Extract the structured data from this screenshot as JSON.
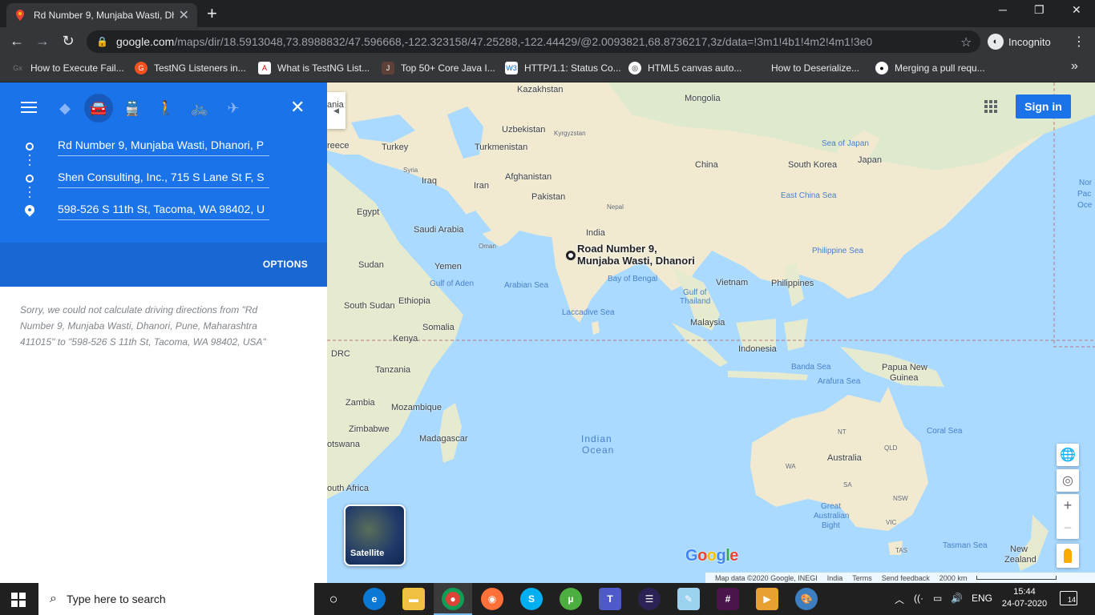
{
  "browser": {
    "tab_title": "Rd Number 9, Munjaba Wasti, Dh",
    "url_host": "google.com",
    "url_path": "/maps/dir/18.5913048,73.8988832/47.596668,-122.323158/47.25288,-122.44429/@2.0093821,68.8736217,3z/data=!3m1!4b1!4m2!4m1!3e0",
    "profile_label": "Incognito",
    "bookmarks": [
      "How to Execute Fail...",
      "TestNG Listeners in...",
      "What is TestNG List...",
      "Top 50+ Core Java I...",
      "HTTP/1.1: Status Co...",
      "HTML5 canvas auto...",
      "How to Deserialize...",
      "Merging a pull requ..."
    ],
    "bookmark_more": "»"
  },
  "directions": {
    "waypoints": [
      "Rd Number 9, Munjaba Wasti, Dhanori, P",
      "Shen Consulting, Inc., 715 S Lane St F, S",
      "598-526 S 11th St, Tacoma, WA 98402, U"
    ],
    "options_label": "OPTIONS",
    "error_message": "Sorry, we could not calculate driving directions from \"Rd Number 9, Munjaba Wasti, Dhanori, Pune, Maharashtra 411015\" to \"598-526 S 11th St, Tacoma, WA 98402, USA\""
  },
  "map": {
    "signin_label": "Sign in",
    "satellite_label": "Satellite",
    "marker_label_line1": "Road Number 9,",
    "marker_label_line2": "Munjaba Wasti, Dhanori",
    "google_logo": "Google",
    "footer": {
      "map_data": "Map data ©2020 Google, INEGI",
      "region": "India",
      "terms": "Terms",
      "feedback": "Send feedback",
      "scale": "2000 km"
    },
    "labels": {
      "kazakhstan": "Kazakhstan",
      "mongolia": "Mongolia",
      "uzbekistan": "Uzbekistan",
      "kyrgyzstan": "Kyrgyzstan",
      "turkmenistan": "Turkmenistan",
      "turkey": "Turkey",
      "greece": "reece",
      "syria": "Syria",
      "iraq": "Iraq",
      "iran": "Iran",
      "afghanistan": "Afghanistan",
      "pakistan": "Pakistan",
      "nepal": "Nepal",
      "china": "China",
      "south_korea": "South Korea",
      "japan": "Japan",
      "sea_of_japan": "Sea of Japan",
      "east_china_sea": "East China Sea",
      "egypt": "Egypt",
      "saudi_arabia": "Saudi Arabia",
      "oman": "Oman",
      "india": "India",
      "yemen": "Yemen",
      "sudan": "Sudan",
      "gulf_of_aden": "Gulf of Aden",
      "arabian_sea": "Arabian Sea",
      "bay_of_bengal": "Bay of Bengal",
      "vietnam": "Vietnam",
      "philippines": "Philippines",
      "philippine_sea": "Philippine Sea",
      "gulf_of_thailand_1": "Gulf of",
      "gulf_of_thailand_2": "Thailand",
      "south_sudan": "South Sudan",
      "ethiopia": "Ethiopia",
      "laccadive_sea": "Laccadive Sea",
      "somalia": "Somalia",
      "malaysia": "Malaysia",
      "kenya": "Kenya",
      "drc": "DRC",
      "indonesia": "Indonesia",
      "tanzania": "Tanzania",
      "banda_sea": "Banda Sea",
      "papua_1": "Papua New",
      "papua_2": "Guinea",
      "arafura_sea": "Arafura Sea",
      "zambia": "Zambia",
      "mozambique": "Mozambique",
      "nt": "NT",
      "qld": "QLD",
      "coral_sea": "Coral Sea",
      "zimbabwe": "Zimbabwe",
      "indian_ocean_1": "Indian",
      "indian_ocean_2": "Ocean",
      "madagascar": "Madagascar",
      "botswana": "otswana",
      "wa": "WA",
      "australia": "Australia",
      "sa": "SA",
      "nsw": "NSW",
      "south_africa": "outh Africa",
      "great_australian_1": "Great",
      "great_australian_2": "Australian",
      "great_australian_3": "Bight",
      "vic": "VIC",
      "tas": "TAS",
      "tasman_sea": "Tasman Sea",
      "new_zealand_1": "New",
      "new_zealand_2": "Zealand",
      "north_pacific_1": "Nor",
      "north_pacific_2": "Pac",
      "north_pacific_3": "Oce",
      "lania": "ania"
    }
  },
  "taskbar": {
    "search_placeholder": "Type here to search",
    "language": "ENG",
    "time": "15:44",
    "date": "24-07-2020",
    "notification_count": "14"
  }
}
